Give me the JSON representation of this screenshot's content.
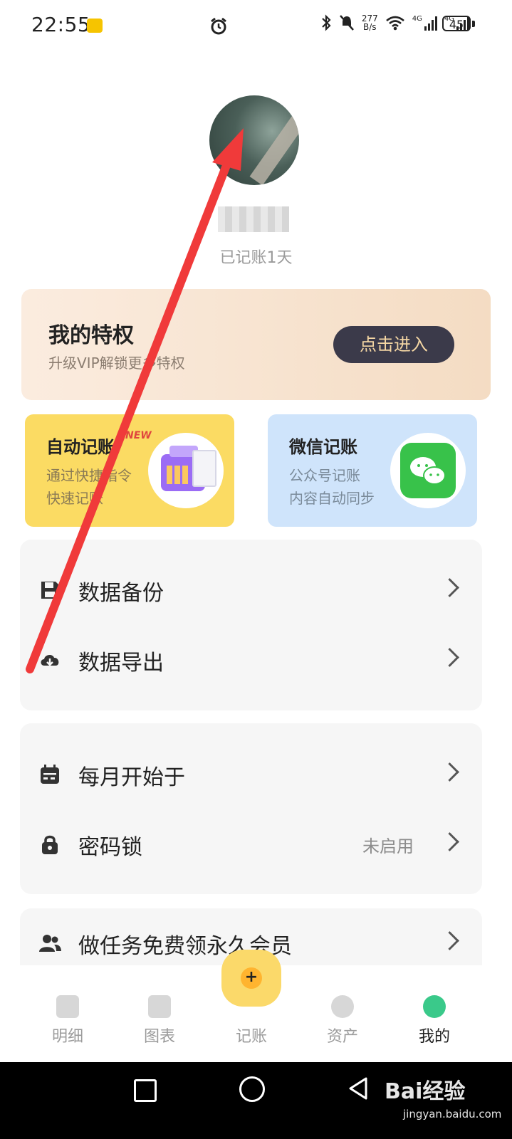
{
  "status_bar": {
    "time": "22:55",
    "net_speed_value": "277",
    "net_speed_unit": "B/s",
    "sig1_label": "4G",
    "sig2_label": "4G",
    "battery": "45"
  },
  "profile": {
    "record_days": "已记账1天"
  },
  "privilege": {
    "title": "我的特权",
    "subtitle": "升级VIP解锁更多特权",
    "button": "点击进入"
  },
  "features": {
    "auto": {
      "title": "自动记账",
      "badge": "NEW",
      "line1": "通过快捷指令",
      "line2": "快速记账"
    },
    "wechat": {
      "title": "微信记账",
      "line1": "公众号记账",
      "line2": "内容自动同步"
    }
  },
  "menu": {
    "backup": "数据备份",
    "export": "数据导出",
    "month_start": "每月开始于",
    "password_lock": "密码锁",
    "password_lock_value": "未启用",
    "tasks": "做任务免费领永久会员"
  },
  "tabs": {
    "detail": "明细",
    "chart": "图表",
    "record": "记账",
    "assets": "资产",
    "mine": "我的"
  },
  "fab_symbol": "+",
  "watermark": {
    "brand": "Bai经验",
    "url": "jingyan.baidu.com"
  },
  "colors": {
    "annotation_arrow": "#f03a3a",
    "accent": "#fbd96a",
    "active_tab": "#3ac98a"
  }
}
